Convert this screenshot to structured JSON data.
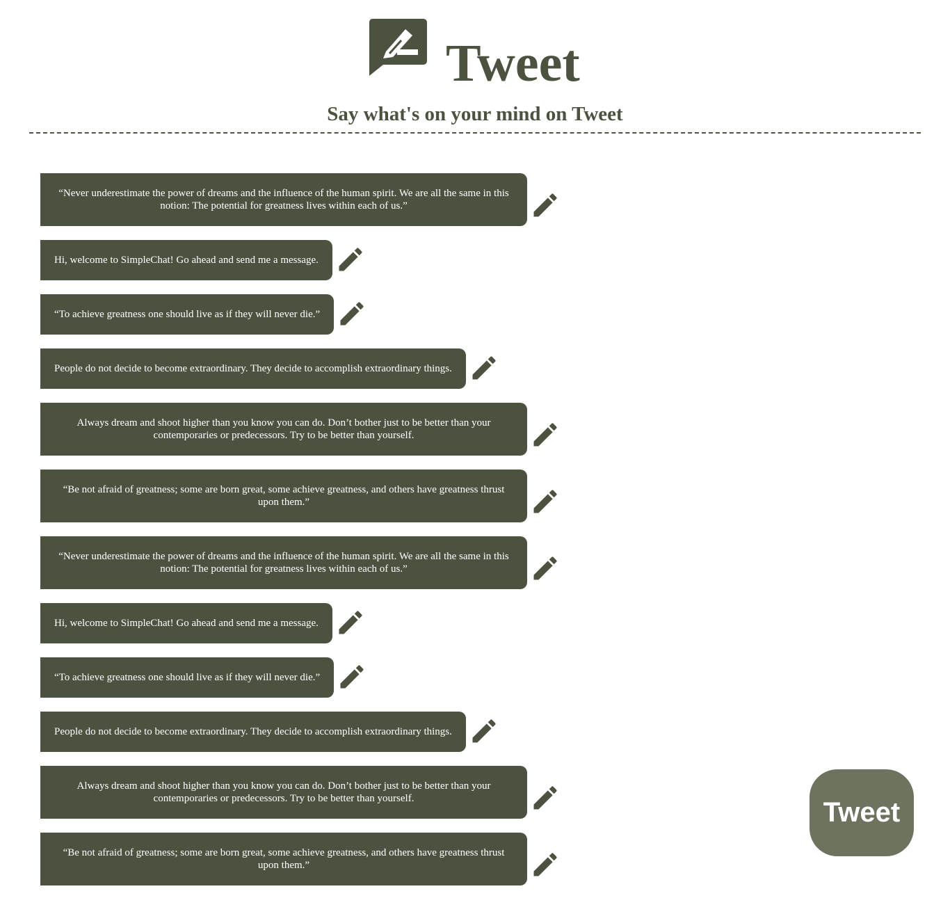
{
  "header": {
    "title": "Tweet",
    "subtitle": "Say what's on your mind on Tweet"
  },
  "tweets": [
    {
      "text": "“Never underestimate the power of dreams and the influence of the human spirit. We are all the same in this notion: The potential for greatness lives within each of us.”"
    },
    {
      "text": "Hi, welcome to SimpleChat! Go ahead and send me a message."
    },
    {
      "text": "“To achieve greatness one should live as if they will never die.”"
    },
    {
      "text": "People do not decide to become extraordinary. They decide to accomplish extraordinary things."
    },
    {
      "text": "Always dream and shoot higher than you know you can do. Don’t bother just to be better than your contemporaries or predecessors. Try to be better than yourself."
    },
    {
      "text": "“Be not afraid of greatness; some are born great, some achieve greatness, and others have greatness thrust upon them.”"
    },
    {
      "text": "“Never underestimate the power of dreams and the influence of the human spirit. We are all the same in this notion: The potential for greatness lives within each of us.”"
    },
    {
      "text": "Hi, welcome to SimpleChat! Go ahead and send me a message."
    },
    {
      "text": "“To achieve greatness one should live as if they will never die.”"
    },
    {
      "text": "People do not decide to become extraordinary. They decide to accomplish extraordinary things."
    },
    {
      "text": "Always dream and shoot higher than you know you can do. Don’t bother just to be better than your contemporaries or predecessors. Try to be better than yourself."
    },
    {
      "text": "“Be not afraid of greatness; some are born great, some achieve greatness, and others have greatness thrust upon them.”"
    }
  ],
  "tweet_button": {
    "label": "Tweet"
  },
  "icons": {
    "logo": "chat-pencil-icon",
    "edit": "pencil-icon"
  },
  "colors": {
    "primary": "#4b5340",
    "button": "#6e7360",
    "text_on_primary": "#ffffff",
    "background": "#ffffff"
  }
}
